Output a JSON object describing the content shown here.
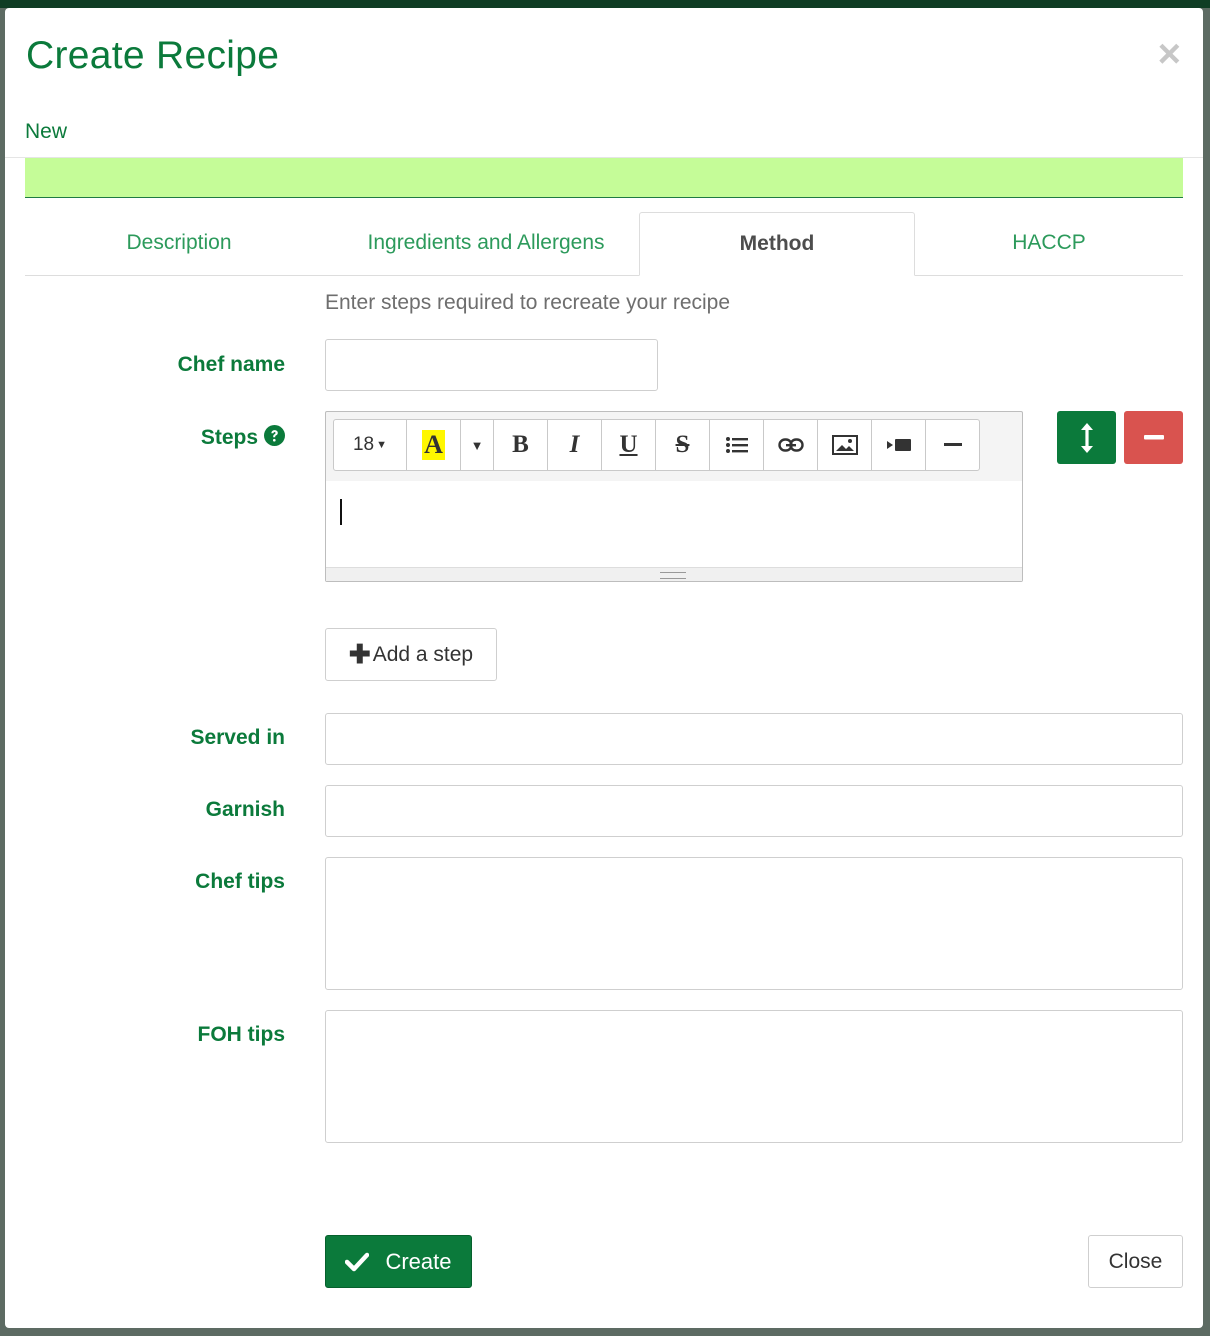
{
  "modal": {
    "title": "Create Recipe",
    "close_glyph": "×",
    "subtitle": "New"
  },
  "tabs": [
    {
      "label": "Description",
      "active": false
    },
    {
      "label": "Ingredients and Allergens",
      "active": false
    },
    {
      "label": "Method",
      "active": true
    },
    {
      "label": "HACCP",
      "active": false
    }
  ],
  "method": {
    "hint": "Enter steps required to recreate your recipe",
    "chef_name_label": "Chef name",
    "chef_name_value": "",
    "steps_label": "Steps",
    "editor": {
      "font_size": "18",
      "highlight_glyph": "A",
      "bold": "B",
      "italic": "I",
      "underline": "U",
      "strikethrough": "S",
      "content": ""
    },
    "add_step_label": "Add a step",
    "served_in_label": "Served in",
    "served_in_value": "",
    "garnish_label": "Garnish",
    "garnish_value": "",
    "chef_tips_label": "Chef tips",
    "chef_tips_value": "",
    "foh_tips_label": "FOH tips",
    "foh_tips_value": ""
  },
  "footer": {
    "create_label": "Create",
    "close_label": "Close"
  },
  "colors": {
    "brand_green": "#0b7a3b",
    "light_green_bar": "#c5fc98",
    "danger_red": "#d9534f",
    "highlight_yellow": "#fff700"
  }
}
